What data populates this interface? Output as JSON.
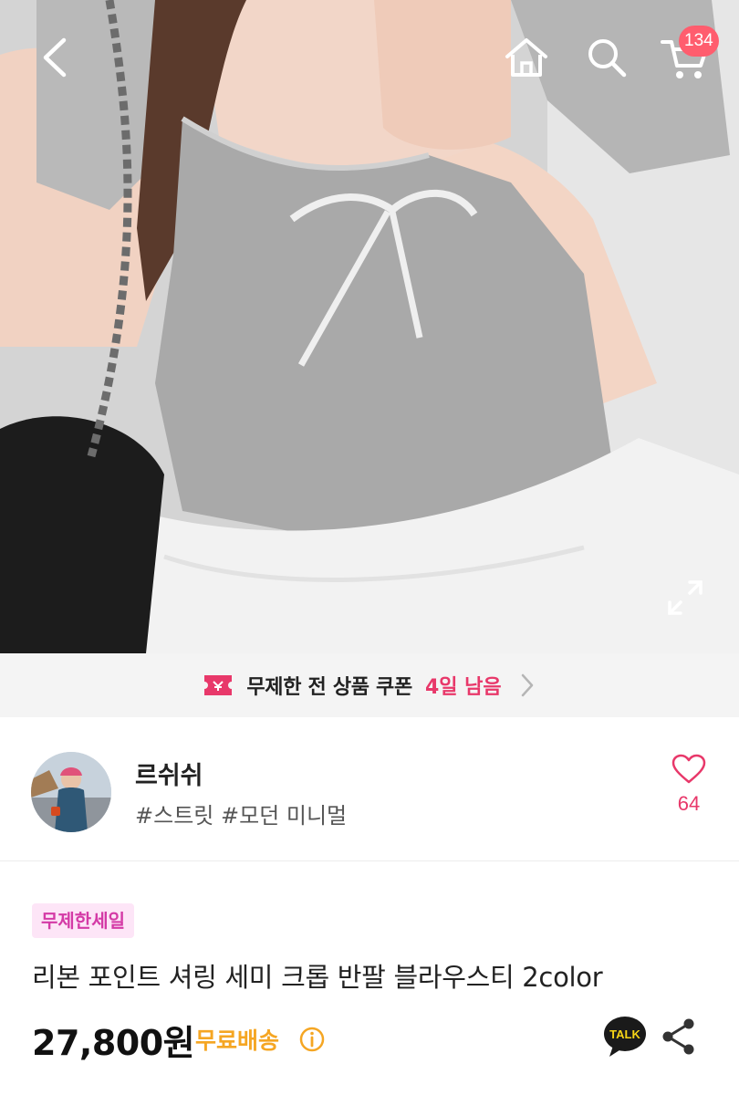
{
  "header": {
    "cart_count": "134",
    "icons": [
      "back-arrow-icon",
      "home-icon",
      "search-icon",
      "cart-icon",
      "expand-icon"
    ]
  },
  "coupon": {
    "text": "무제한 전 상품 쿠폰",
    "remaining": "4일 남음"
  },
  "shop": {
    "name": "르쉬쉬",
    "tags": "#스트릿 #모던 미니멀",
    "likes": "64"
  },
  "product": {
    "badge": "무제한세일",
    "title": "리본 포인트 셔링 세미 크롭 반팔 블라우스티 2color",
    "price": "27,800원",
    "shipping": "무료배송",
    "talk_label": "TALK"
  },
  "colors": {
    "accent_pink": "#e8386a",
    "badge_bg": "#fde5f7",
    "badge_text": "#d43aa6",
    "shipping_orange": "#f5a623",
    "cart_badge": "#ff5d6e"
  }
}
